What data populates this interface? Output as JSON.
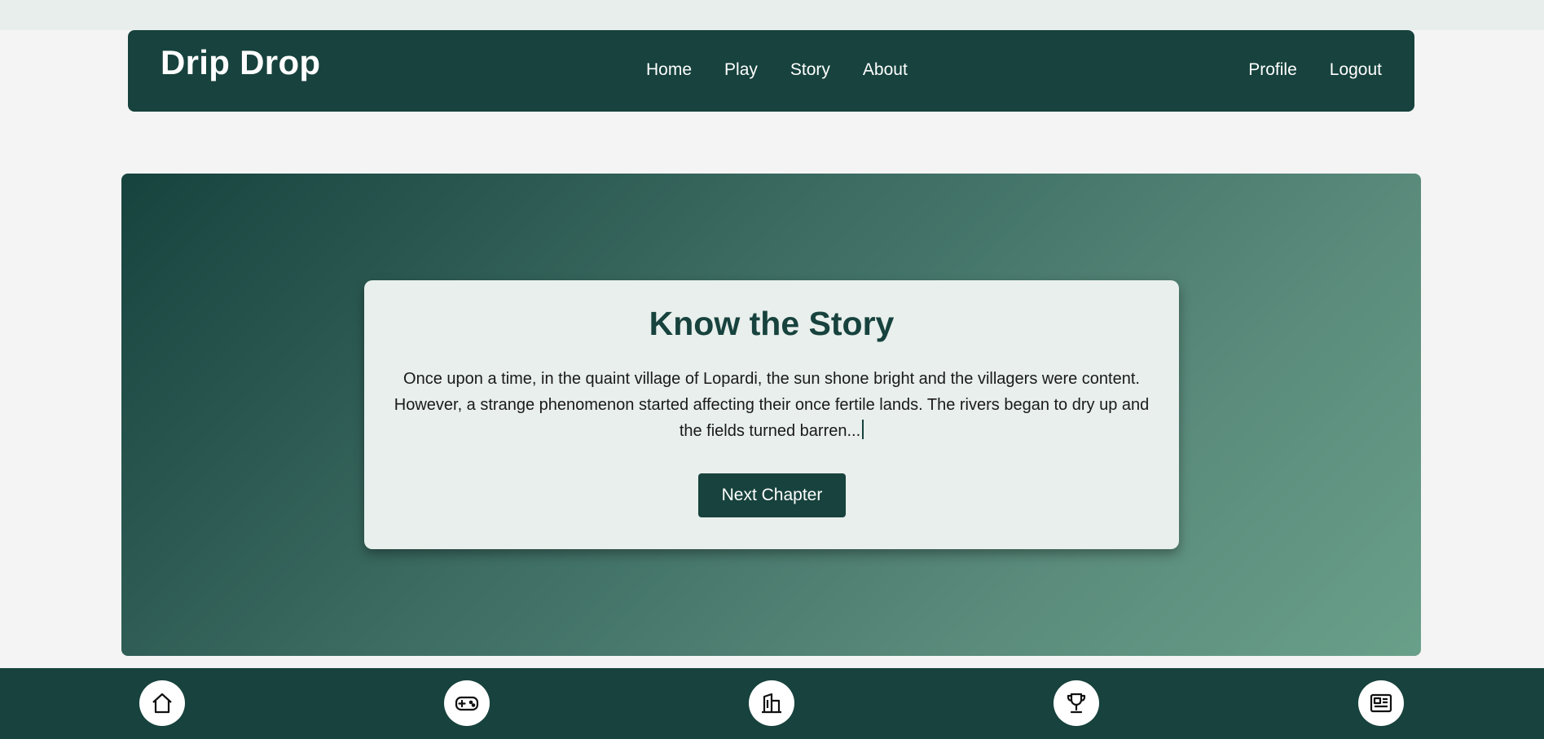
{
  "brand": "Drip Drop",
  "nav": {
    "center": [
      "Home",
      "Play",
      "Story",
      "About"
    ],
    "right": [
      "Profile",
      "Logout"
    ]
  },
  "story": {
    "title": "Know the Story",
    "text": "Once upon a time, in the quaint village of Lopardi, the sun shone bright and the villagers were content. However, a strange phenomenon started affecting their once fertile lands. The rivers began to dry up and the fields turned barren...",
    "button": "Next Chapter"
  },
  "footer_icons": [
    "home-icon",
    "gamepad-icon",
    "building-icon",
    "trophy-icon",
    "newspaper-icon"
  ],
  "colors": {
    "primary": "#17423d",
    "card": "#e8efec",
    "page": "#f4f4f4"
  }
}
